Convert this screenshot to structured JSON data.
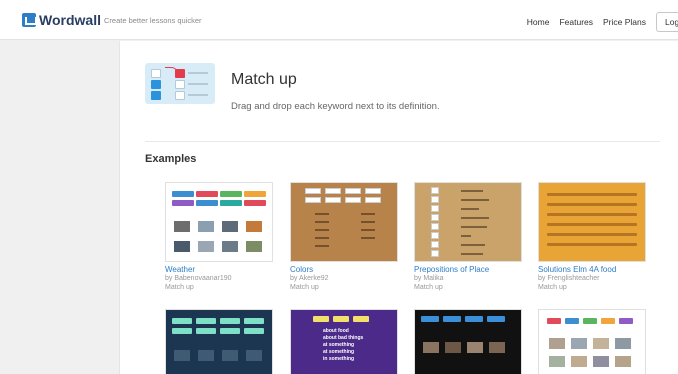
{
  "header": {
    "logo_text": "Wordwall",
    "tagline": "Create better lessons quicker",
    "nav": [
      "Home",
      "Features",
      "Price Plans"
    ],
    "login_label": "Log in"
  },
  "template": {
    "title": "Match up",
    "description": "Drag and drop each keyword next to its definition."
  },
  "examples": {
    "heading": "Examples",
    "cards": [
      {
        "title": "Weather",
        "author": "by Babenovaanar190",
        "type": "Match up"
      },
      {
        "title": "Colors",
        "author": "by Akerke92",
        "type": "Match up"
      },
      {
        "title": "Prepositions of Place",
        "author": "by Malika",
        "type": "Match up"
      },
      {
        "title": "Solutions Elm 4A food",
        "author": "by Frenglishteacher",
        "type": "Match up"
      },
      {
        "title": "",
        "author": "",
        "type": ""
      },
      {
        "title": "",
        "author": "",
        "type": ""
      },
      {
        "title": "",
        "author": "",
        "type": ""
      },
      {
        "title": "",
        "author": "",
        "type": ""
      }
    ]
  },
  "thumb_text": {
    "card5_lines": [
      "about bad things",
      "at something",
      "at something",
      "in something"
    ],
    "card5_first": "about food"
  },
  "colors": {
    "accent_blue": "#2e7ec7",
    "accent_red": "#e23c4c",
    "template_bg": "#d8ecf8"
  }
}
